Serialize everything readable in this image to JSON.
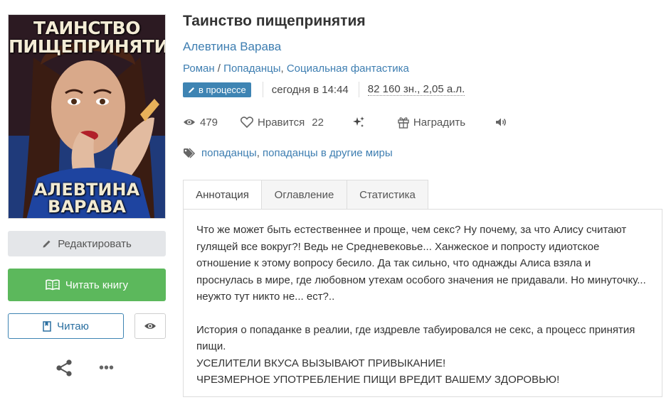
{
  "cover": {
    "title_line1": "ТАИНСТВО",
    "title_line2": "ПИЩЕПРИНЯТИЯ",
    "author_line1": "АЛЕВТИНА",
    "author_line2": "ВАРАВА"
  },
  "sidebar": {
    "edit_label": "Редактировать",
    "read_label": "Читать книгу",
    "reading_label": "Читаю",
    "more_label": "•••"
  },
  "book": {
    "title": "Таинство пищепринятия",
    "author": "Алевтина Варава",
    "genres": [
      "Роман",
      "Попаданцы",
      "Социальная фантастика"
    ],
    "genre_sep1": " / ",
    "genre_sep2": ", ",
    "status_badge": "в процессе",
    "updated": "сегодня в 14:44",
    "size": "82 160 зн., 2,05 а.л."
  },
  "stats": {
    "views": "479",
    "likes_label": "Нравится",
    "likes": "22",
    "reward_label": "Наградить"
  },
  "tags": [
    "попаданцы",
    "попаданцы в другие миры"
  ],
  "tags_sep": ", ",
  "tabs": [
    "Аннотация",
    "Оглавление",
    "Статистика"
  ],
  "annotation": {
    "para1": "Что же может быть естественнее и проще, чем секс? Ну почему, за что Алису считают гулящей все вокруг?! Ведь не Средневековье... Ханжеское и попросту идиотское отношение к этому вопросу бесило. Да так сильно, что однажды Алиса взяла и проснулась в мире, где любовном утехам особого значения не придавали. Но минуточку... неужто тут никто не... ест?..",
    "para2": "История о попаданке в реалии, где издревле табуировался не секс, а процесс принятия пищи.",
    "line3": "УСЕЛИТЕЛИ ВКУСА ВЫЗЫВАЮТ ПРИВЫКАНИЕ!",
    "line4": "ЧРЕЗМЕРНОЕ УПОТРЕБЛЕНИЕ ПИЩИ ВРЕДИТ ВАШЕМУ ЗДОРОВЬЮ!"
  },
  "colors": {
    "link": "#3e7eb1",
    "badge": "#3e84b3",
    "read_button": "#5cb85c"
  }
}
